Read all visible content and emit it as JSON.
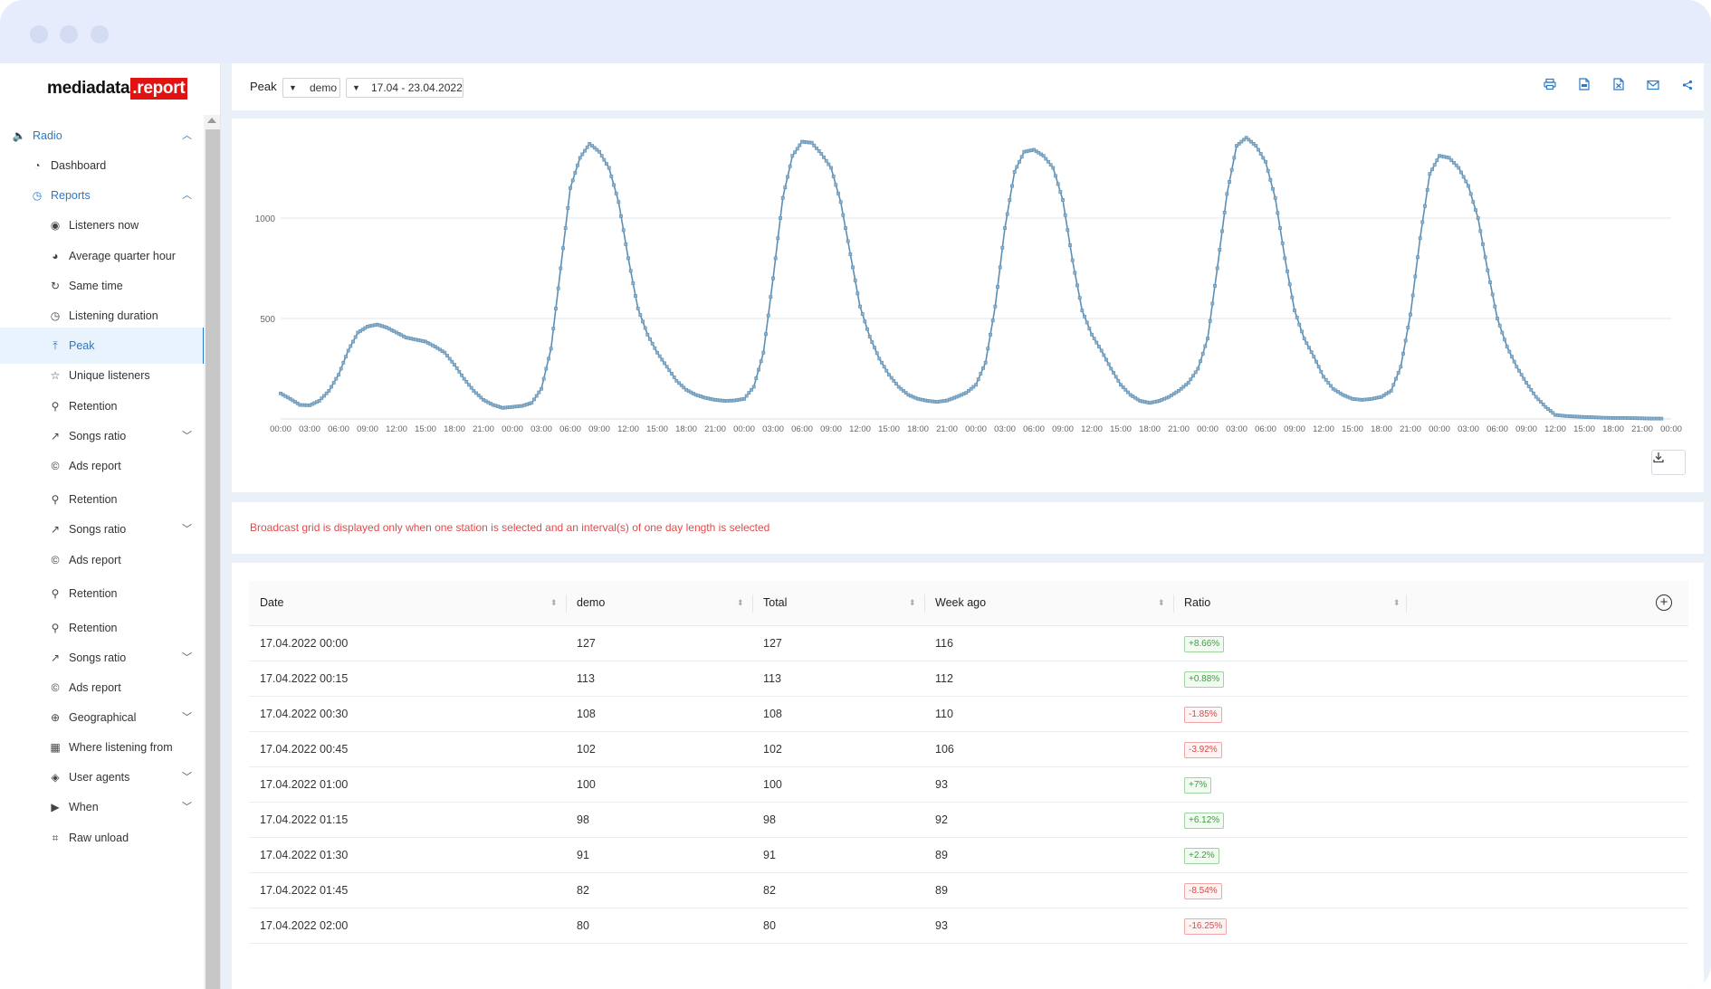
{
  "logo": {
    "main": "mediadata",
    "accent": ".report"
  },
  "sidebar": {
    "items": [
      {
        "label": "Radio",
        "icon": "speaker-icon",
        "level": 0,
        "chevron": "up"
      },
      {
        "label": "Dashboard",
        "icon": "gauge-icon",
        "level": 1
      },
      {
        "label": "Reports",
        "icon": "clock-icon",
        "level": 1,
        "chevron": "up"
      },
      {
        "label": "Listeners now",
        "icon": "eye-icon",
        "level": 2
      },
      {
        "label": "Average quarter hour",
        "icon": "pie-icon",
        "level": 2
      },
      {
        "label": "Same time",
        "icon": "reload-icon",
        "level": 2
      },
      {
        "label": "Listening duration",
        "icon": "clock-icon",
        "level": 2
      },
      {
        "label": "Peak",
        "icon": "vertical-align-top-icon",
        "level": 2,
        "active": true
      },
      {
        "label": "Unique listeners",
        "icon": "star-icon",
        "level": 2
      },
      {
        "label": "Retention",
        "icon": "link-icon",
        "level": 2
      },
      {
        "label": "Songs ratio",
        "icon": "rise-icon",
        "level": 2,
        "chevron": "down"
      },
      {
        "label": "Ads report",
        "icon": "copyright-icon",
        "level": 2
      },
      {
        "label": "Retention",
        "icon": "link-icon",
        "level": 2
      },
      {
        "label": "Songs ratio",
        "icon": "rise-icon",
        "level": 2,
        "chevron": "down"
      },
      {
        "label": "Ads report",
        "icon": "copyright-icon",
        "level": 2
      },
      {
        "label": "Retention",
        "icon": "link-icon",
        "level": 2
      },
      {
        "label": "Retention",
        "icon": "link-icon",
        "level": 2
      },
      {
        "label": "Songs ratio",
        "icon": "rise-icon",
        "level": 2,
        "chevron": "down"
      },
      {
        "label": "Ads report",
        "icon": "copyright-icon",
        "level": 2
      },
      {
        "label": "Geographical",
        "icon": "globe-icon",
        "level": 2,
        "chevron": "down"
      },
      {
        "label": "Where listening from",
        "icon": "building-icon",
        "level": 2
      },
      {
        "label": "User agents",
        "icon": "api-icon",
        "level": 2,
        "chevron": "down"
      },
      {
        "label": "When",
        "icon": "play-circle-icon",
        "level": 2,
        "chevron": "down"
      },
      {
        "label": "Raw unload",
        "icon": "scan-icon",
        "level": 2
      }
    ]
  },
  "toolbar": {
    "title": "Peak",
    "station_value": "demo",
    "date_value": "17.04 - 23.04.2022",
    "actions": [
      "printer-icon",
      "pdf-file-icon",
      "excel-file-icon",
      "mail-icon",
      "share-icon"
    ]
  },
  "chart_data": {
    "type": "line",
    "title": "",
    "xlabel": "",
    "ylabel": "",
    "ylim": [
      0,
      1400
    ],
    "yticks": [
      500,
      1000
    ],
    "x_ticks": [
      "00:00",
      "03:00",
      "06:00",
      "09:00",
      "12:00",
      "15:00",
      "18:00",
      "21:00",
      "00:00",
      "03:00",
      "06:00",
      "09:00",
      "12:00",
      "15:00",
      "18:00",
      "21:00",
      "00:00",
      "03:00",
      "06:00",
      "09:00",
      "12:00",
      "15:00",
      "18:00",
      "21:00",
      "00:00",
      "03:00",
      "06:00",
      "09:00",
      "12:00",
      "15:00",
      "18:00",
      "21:00",
      "00:00",
      "03:00",
      "06:00",
      "09:00",
      "12:00",
      "15:00",
      "18:00",
      "21:00",
      "00:00",
      "03:00",
      "06:00",
      "09:00",
      "12:00",
      "15:00",
      "18:00",
      "21:00",
      "00:00"
    ],
    "hourly_by_day": [
      [
        127,
        100,
        70,
        68,
        90,
        140,
        220,
        340,
        430,
        460,
        470,
        455,
        430,
        405,
        395,
        385,
        360,
        330,
        270,
        200,
        140,
        95,
        70,
        55
      ],
      [
        60,
        65,
        80,
        150,
        350,
        750,
        1150,
        1300,
        1370,
        1330,
        1250,
        1080,
        800,
        550,
        420,
        330,
        260,
        190,
        145,
        120,
        105,
        95,
        90,
        92
      ],
      [
        100,
        160,
        330,
        700,
        1100,
        1310,
        1380,
        1375,
        1320,
        1250,
        1080,
        820,
        560,
        410,
        300,
        220,
        160,
        120,
        100,
        90,
        85,
        92,
        110,
        130
      ],
      [
        170,
        280,
        560,
        950,
        1230,
        1330,
        1340,
        1310,
        1250,
        1090,
        790,
        540,
        420,
        340,
        250,
        170,
        120,
        90,
        80,
        90,
        110,
        140,
        180,
        250
      ],
      [
        400,
        750,
        1120,
        1360,
        1400,
        1360,
        1280,
        1100,
        800,
        540,
        400,
        310,
        210,
        150,
        120,
        100,
        95,
        100,
        110,
        140,
        260,
        520,
        900,
        1220
      ],
      [
        1310,
        1300,
        1250,
        1160,
        1000,
        740,
        500,
        360,
        260,
        180,
        110,
        60,
        20,
        15,
        12,
        10,
        8,
        6,
        5,
        5,
        4,
        3,
        2,
        2
      ]
    ]
  },
  "notice": "Broadcast grid is displayed only when one station is selected and an interval(s) of one day length is selected",
  "table": {
    "columns": [
      "Date",
      "demo",
      "Total",
      "Week ago",
      "Ratio"
    ],
    "rows": [
      {
        "date": "17.04.2022 00:00",
        "demo": "127",
        "total": "127",
        "week_ago": "116",
        "ratio": "+8.66%",
        "trend": "up"
      },
      {
        "date": "17.04.2022 00:15",
        "demo": "113",
        "total": "113",
        "week_ago": "112",
        "ratio": "+0.88%",
        "trend": "up"
      },
      {
        "date": "17.04.2022 00:30",
        "demo": "108",
        "total": "108",
        "week_ago": "110",
        "ratio": "-1.85%",
        "trend": "down"
      },
      {
        "date": "17.04.2022 00:45",
        "demo": "102",
        "total": "102",
        "week_ago": "106",
        "ratio": "-3.92%",
        "trend": "down"
      },
      {
        "date": "17.04.2022 01:00",
        "demo": "100",
        "total": "100",
        "week_ago": "93",
        "ratio": "+7%",
        "trend": "up"
      },
      {
        "date": "17.04.2022 01:15",
        "demo": "98",
        "total": "98",
        "week_ago": "92",
        "ratio": "+6.12%",
        "trend": "up"
      },
      {
        "date": "17.04.2022 01:30",
        "demo": "91",
        "total": "91",
        "week_ago": "89",
        "ratio": "+2.2%",
        "trend": "up"
      },
      {
        "date": "17.04.2022 01:45",
        "demo": "82",
        "total": "82",
        "week_ago": "89",
        "ratio": "-8.54%",
        "trend": "down"
      },
      {
        "date": "17.04.2022 02:00",
        "demo": "80",
        "total": "80",
        "week_ago": "93",
        "ratio": "-16.25%",
        "trend": "down"
      }
    ]
  },
  "colors": {
    "accent": "#2a78c8",
    "line": "#5b8fb6",
    "brand_red": "#e11212",
    "notice": "#e24a4a",
    "up": "#3f9b3f",
    "down": "#d84a4a"
  }
}
